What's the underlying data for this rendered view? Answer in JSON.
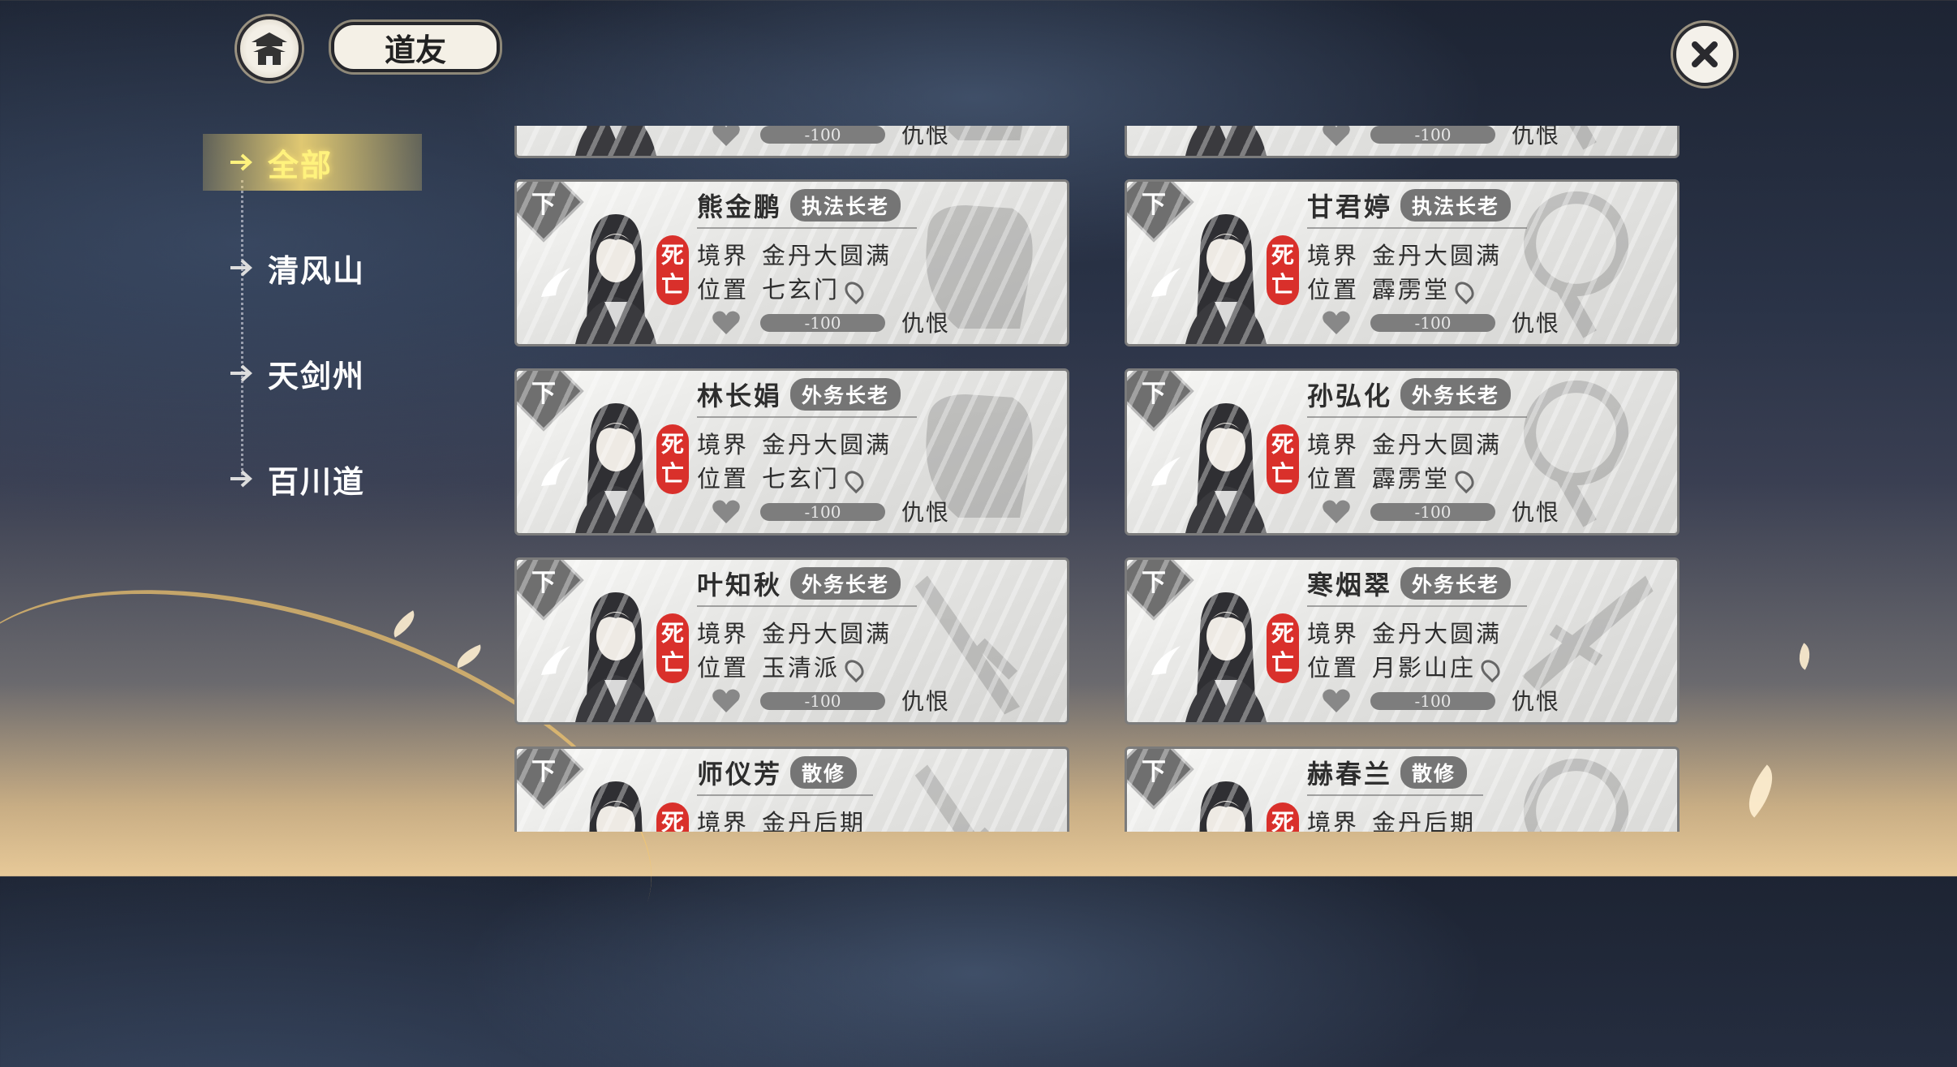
{
  "header": {
    "title": "道友"
  },
  "nav": {
    "items": [
      {
        "label": "全部",
        "active": true
      },
      {
        "label": "清风山"
      },
      {
        "label": "天剑州"
      },
      {
        "label": "百川道"
      }
    ]
  },
  "labels": {
    "realm": "境界",
    "location": "位置",
    "hate": "仇恨",
    "down": "下",
    "dead": "死亡"
  },
  "cards": [
    {
      "name": "",
      "role": "",
      "realm": "",
      "location": "",
      "favor": "-100",
      "emblem": "fist"
    },
    {
      "name": "",
      "role": "",
      "realm": "",
      "location": "",
      "favor": "-100",
      "emblem": "round"
    },
    {
      "name": "熊金鹏",
      "role": "执法长老",
      "realm": "金丹大圆满",
      "location": "七玄门",
      "favor": "-100",
      "emblem": "fist"
    },
    {
      "name": "甘君婷",
      "role": "执法长老",
      "realm": "金丹大圆满",
      "location": "霹雳堂",
      "favor": "-100",
      "emblem": "round"
    },
    {
      "name": "林长娟",
      "role": "外务长老",
      "realm": "金丹大圆满",
      "location": "七玄门",
      "favor": "-100",
      "emblem": "fist"
    },
    {
      "name": "孙弘化",
      "role": "外务长老",
      "realm": "金丹大圆满",
      "location": "霹雳堂",
      "favor": "-100",
      "emblem": "round"
    },
    {
      "name": "叶知秋",
      "role": "外务长老",
      "realm": "金丹大圆满",
      "location": "玉清派",
      "favor": "-100",
      "emblem": "sword"
    },
    {
      "name": "寒烟翠",
      "role": "外务长老",
      "realm": "金丹大圆满",
      "location": "月影山庄",
      "favor": "-100",
      "emblem": "spear"
    },
    {
      "name": "师仪芳",
      "role": "散修",
      "realm": "金丹后期",
      "location": "",
      "favor": "",
      "emblem": "sword"
    },
    {
      "name": "赫春兰",
      "role": "散修",
      "realm": "金丹后期",
      "location": "",
      "favor": "",
      "emblem": "round"
    }
  ],
  "colors": {
    "active_nav": "#fff27d",
    "dead_seal": "#d9302b",
    "card_bg": "#e6e6e4"
  }
}
